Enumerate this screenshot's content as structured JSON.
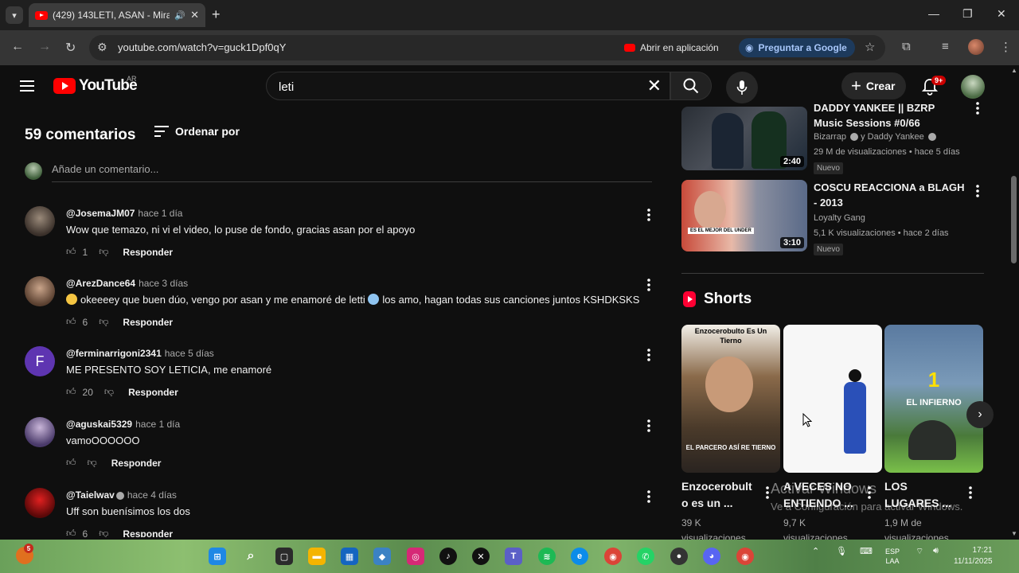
{
  "browser": {
    "tab_title": "(429) 143LETI, ASAN - Mira",
    "url": "youtube.com/watch?v=guck1Dpf0qY",
    "open_in_app_label": "Abrir en aplicación",
    "ask_google_label": "Preguntar a Google"
  },
  "youtube_header": {
    "logo_text": "YouTube",
    "country_code": "AR",
    "search_query": "leti",
    "create_label": "Crear",
    "notifications_badge": "9+"
  },
  "comments": {
    "count_label": "59 comentarios",
    "sort_label": "Ordenar por",
    "add_placeholder": "Añade un comentario...",
    "reply_label": "Responder",
    "items": [
      {
        "author": "@JosemaJM07",
        "time": "hace 1 día",
        "text": "Wow que temazo, ni vi el video, lo puse de fondo, gracias asan por el apoyo",
        "likes": "1"
      },
      {
        "author": "@ArezDance64",
        "time": "hace 3 días",
        "text": "okeeeey que buen dúo, vengo por asan y me enamoré de letti",
        "text2": "los amo, hagan todas sus canciones juntos KSHDKSKS",
        "likes": "6"
      },
      {
        "author": "@ferminarrigoni2341",
        "time": "hace 5 días",
        "text": "ME PRESENTO SOY LETICIA, me enamoré",
        "likes": "20",
        "avatar_letter": "F"
      },
      {
        "author": "@aguskai5329",
        "time": "hace 1 día",
        "text": "vamoOOOOOO",
        "likes": ""
      },
      {
        "author": "@Taielwav",
        "time": "hace 4 días",
        "text": "Uff son buenísimos los dos",
        "likes": "6"
      }
    ]
  },
  "sidebar": {
    "videos": [
      {
        "title": "DADDY YANKEE || BZRP Music Sessions #0/66",
        "channel": "Bizarrap",
        "channel2": "y Daddy Yankee",
        "meta": "29 M de visualizaciones • hace 5 días",
        "badge": "Nuevo",
        "duration": "2:40"
      },
      {
        "title": "COSCU REACCIONA a BLAGH - 2013",
        "channel": "Loyalty Gang",
        "meta": "5,1 K visualizaciones • hace 2 días",
        "badge": "Nuevo",
        "duration": "3:10",
        "thumb_text": "ES EL MEJOR DEL UNDER"
      }
    ],
    "shorts_title": "Shorts",
    "shorts": [
      {
        "caption_line1": "Enzocerobult",
        "caption_line2": "o es un ...",
        "views": "39 K",
        "views_label": "visualizaciones",
        "thumb_top": "Enzocerobulto Es Un Tierno",
        "thumb_bottom": "EL PARCERO ASÍ RE TIERNO"
      },
      {
        "caption_line1": "A VECES NO",
        "caption_line2": "ENTIENDO ...",
        "views": "9,7 K",
        "views_label": "visualizaciones"
      },
      {
        "caption_line1": "LOS",
        "caption_line2": "LUGARES ...",
        "views": "1,9 M de",
        "views_label": "visualizaciones",
        "thumb_num": "1",
        "thumb_text": "EL INFIERNO"
      }
    ]
  },
  "watermark": {
    "line1": "Activar Windows",
    "line2": "Ve a Configuración para activar Windows."
  },
  "taskbar": {
    "lang_top": "ESP",
    "lang_bottom": "LAA",
    "time": "17:21",
    "date": "11/11/2025",
    "widget_badge": "5"
  },
  "colors": {
    "background": "#0f0f0f",
    "youtube_red": "#ff0000",
    "text_primary": "#f1f1f1",
    "text_secondary": "#aaaaaa"
  }
}
